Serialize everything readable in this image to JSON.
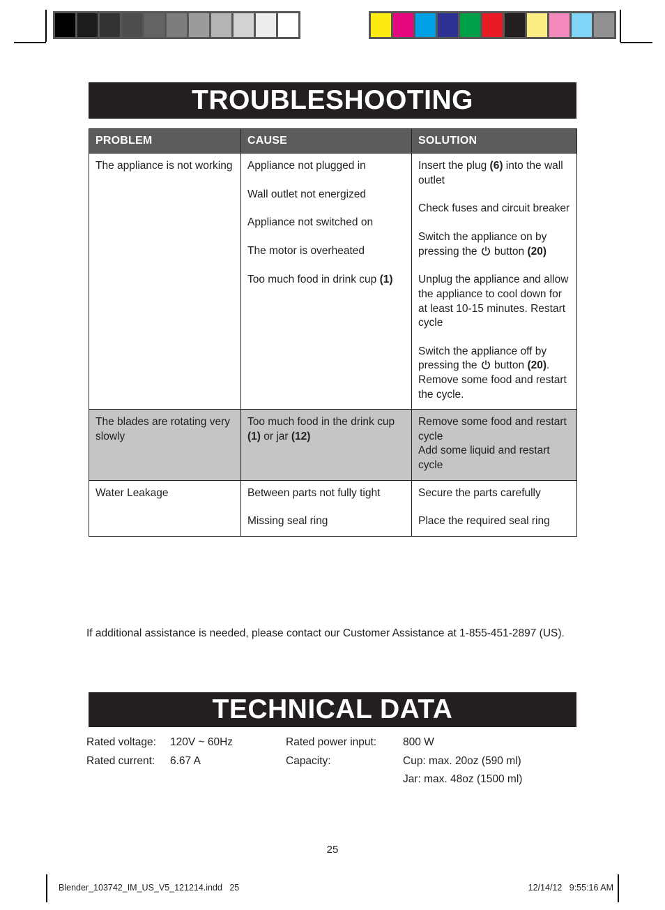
{
  "calibration": {
    "gray_patches": [
      "#000000",
      "#1c1c1c",
      "#333333",
      "#4d4d4d",
      "#636363",
      "#7d7d7d",
      "#9b9b9b",
      "#b5b5b5",
      "#d2d2d2",
      "#ececec",
      "#ffffff"
    ],
    "color_patches": [
      "#fcea10",
      "#e5077e",
      "#00a0e4",
      "#2e3191",
      "#00a04b",
      "#e61b23",
      "#231f20",
      "#faed83",
      "#f489bd",
      "#80d4f5",
      "#919191"
    ]
  },
  "sections": {
    "troubleshooting_title": "TROUBLESHOOTING",
    "technical_data_title": "TECHNICAL DATA"
  },
  "table": {
    "headers": [
      "PROBLEM",
      "CAUSE",
      "SOLUTION"
    ],
    "rows": [
      {
        "shaded": false,
        "problem": "The appliance is not working",
        "causes": [
          "Appliance not plugged in",
          "Wall outlet not energized",
          "Appliance not switched on",
          "The motor is overheated",
          "Too much food in drink cup (1)"
        ],
        "solutions": [
          "Insert the plug (6) into the wall outlet",
          "Check fuses and circuit breaker",
          "Switch the appliance on by pressing the ⏻ button (20)",
          "Unplug the appliance and allow the appliance to cool down for at least 10-15 minutes. Restart cycle",
          "Switch the appliance off by pressing the ⏻ button (20). Remove some food and restart the cycle."
        ]
      },
      {
        "shaded": true,
        "problem": "The blades are rotating very slowly",
        "causes": [
          "Too much food in the drink cup (1) or jar (12)"
        ],
        "solutions": [
          "Remove some food and restart cycle",
          "Add some liquid and restart cycle"
        ]
      },
      {
        "shaded": false,
        "problem": "Water Leakage",
        "causes": [
          "Between parts not fully tight",
          "Missing seal ring"
        ],
        "solutions": [
          "Secure the parts carefully",
          "Place the required seal ring"
        ]
      }
    ]
  },
  "assistance_note": "If additional assistance is needed, please contact our Customer Assistance at 1-855-451-2897 (US).",
  "technical_data": {
    "rated_voltage_label": "Rated voltage:",
    "rated_voltage_value": "120V ~ 60Hz",
    "rated_current_label": "Rated current:",
    "rated_current_value": "6.67 A",
    "rated_power_label": "Rated power input:",
    "rated_power_value": "800 W",
    "capacity_label": "Capacity:",
    "capacity_cup": "Cup: max. 20oz (590 ml)",
    "capacity_jar": "Jar: max. 48oz (1500 ml)"
  },
  "page_number": "25",
  "print_footer": {
    "filename": "Blender_103742_IM_US_V5_121214.indd   25",
    "timestamp": "12/14/12   9:55:16 AM"
  }
}
